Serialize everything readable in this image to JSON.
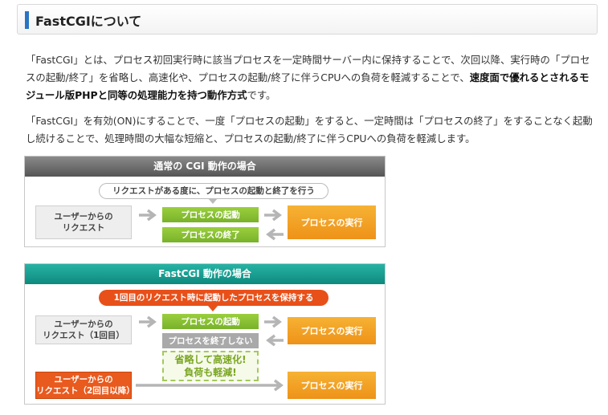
{
  "heading": {
    "title": "FastCGIについて"
  },
  "paragraph1": {
    "text": "「FastCGI」とは、プロセス初回実行時に該当プロセスを一定時間サーバー内に保持することで、次回以降、実行時の「プロセスの起動/終了」を省略し、高速化や、プロセスの起動/終了に伴うCPUへの負荷を軽減することで、",
    "bold": "速度面で優れるとされるモジュール版PHPと同等の処理能力を持つ動作方式",
    "tail": "です。"
  },
  "paragraph2": {
    "text": "「FastCGI」を有効(ON)にすることで、一度「プロセスの起動」をすると、一定時間は「プロセスの終了」をすることなく起動し続けることで、処理時間の大幅な短縮と、プロセスの起動/終了に伴うCPUへの負荷を軽減します。"
  },
  "diagram_cgi": {
    "title": "通常の CGI 動作の場合",
    "callout": "リクエストがある度に、プロセスの起動と終了を行う",
    "user_request": [
      "ユーザーからの",
      "リクエスト"
    ],
    "process_start": "プロセスの起動",
    "process_end": "プロセスの終了",
    "process_run": "プロセスの実行"
  },
  "diagram_fastcgi": {
    "title": "FastCGI 動作の場合",
    "callout": "1回目のリクエスト時に起動したプロセスを保持する",
    "user_request_first": [
      "ユーザーからの",
      "リクエスト（1回目）"
    ],
    "user_request_later": [
      "ユーザーからの",
      "リクエスト（2回目以降）"
    ],
    "process_start": "プロセスの起動",
    "process_no_end": "プロセスを終了しない",
    "highlight": [
      "省略して高速化!",
      "負荷も軽減!"
    ],
    "process_run_1": "プロセスの実行",
    "process_run_2": "プロセスの実行"
  },
  "colors": {
    "heading_bar": "#2a75c3",
    "cgi_header": "#6e6e6e",
    "fastcgi_header": "#14a090",
    "green": "#8cc63f",
    "orange": "#f2a024",
    "red_orange": "#e8501a"
  }
}
